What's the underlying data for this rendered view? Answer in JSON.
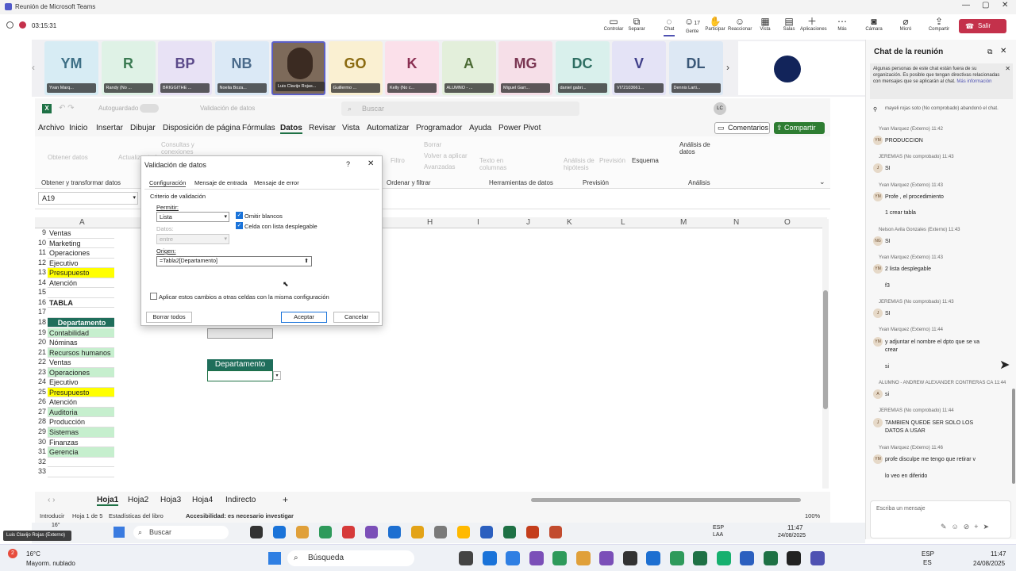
{
  "teams": {
    "window_title": "Reunión de Microsoft Teams",
    "timer": "03:15:31",
    "toolbar": [
      {
        "label": "Controlar",
        "icon": "share-screen-icon"
      },
      {
        "label": "Separar",
        "icon": "popout-icon"
      },
      {
        "label": "Chat",
        "icon": "chat-icon"
      },
      {
        "label": "Gente",
        "icon": "people-icon",
        "count": "17"
      },
      {
        "label": "Participar",
        "icon": "hand-icon"
      },
      {
        "label": "Reaccionar",
        "icon": "smile-icon"
      },
      {
        "label": "Vista",
        "icon": "grid-icon"
      },
      {
        "label": "Salas",
        "icon": "rooms-icon"
      },
      {
        "label": "Aplicaciones",
        "icon": "plus-icon"
      },
      {
        "label": "Más",
        "icon": "more-icon"
      },
      {
        "label": "Cámara",
        "icon": "camera-icon"
      },
      {
        "label": "Micró",
        "icon": "mic-off-icon"
      },
      {
        "label": "Compartir",
        "icon": "share-icon"
      }
    ],
    "leave_label": "Salir",
    "participants": [
      {
        "initials": "YM",
        "name": "Yvan Marq...",
        "bg": "#d7ecf4",
        "fg": "#3d6f85"
      },
      {
        "initials": "R",
        "name": "Randy (No ...",
        "bg": "#dff2e6",
        "fg": "#3a7a52"
      },
      {
        "initials": "BP",
        "name": "BRIGGITHE ...",
        "bg": "#e8e2f5",
        "fg": "#5b4a8a"
      },
      {
        "initials": "NB",
        "name": "Noelia Boza...",
        "bg": "#dbe9f6",
        "fg": "#4a6a8a"
      },
      {
        "initials": "",
        "name": "Luis Clavijo Rojas...",
        "bg": "#7d6a5a",
        "fg": "#fff"
      },
      {
        "initials": "GO",
        "name": "Guillermo ...",
        "bg": "#faf0d2",
        "fg": "#8a6a10"
      },
      {
        "initials": "K",
        "name": "Kelly (No c...",
        "bg": "#fbe0ea",
        "fg": "#8a2f52"
      },
      {
        "initials": "A",
        "name": "ALUMNO - ...",
        "bg": "#e3efdb",
        "fg": "#4c6b35"
      },
      {
        "initials": "MG",
        "name": "Miguel Garr...",
        "bg": "#f6dfe8",
        "fg": "#7a3652"
      },
      {
        "initials": "DC",
        "name": "daniel gabri...",
        "bg": "#d9f0ec",
        "fg": "#2e6e62"
      },
      {
        "initials": "V",
        "name": "VI72103661...",
        "bg": "#e4e3f6",
        "fg": "#3f3f8a"
      },
      {
        "initials": "DL",
        "name": "Dennis Larti...",
        "bg": "#dde8f4",
        "fg": "#3a5878"
      }
    ],
    "presenter_label": "Luis Clavijo Rojas (Externo)"
  },
  "excel": {
    "autosave": "Autoguardado",
    "file": "Validación de datos",
    "search": "Buscar",
    "user": "LC",
    "menu": [
      "Archivo",
      "Inicio",
      "Insertar",
      "Dibujar",
      "Disposición de página",
      "Fórmulas",
      "Datos",
      "Revisar",
      "Vista",
      "Automatizar",
      "Programador",
      "Ayuda",
      "Power Pivot"
    ],
    "comments": "Comentarios",
    "share": "Compartir",
    "ribbon_groups": [
      "Obtener y transformar datos",
      "Ordenar y filtrar",
      "Herramientas de datos",
      "Previsión",
      "Análisis"
    ],
    "ribbon_items": [
      "Obtener datos",
      "Actualizar todo",
      "Consultas y conexiones",
      "Borrar",
      "Volver a aplicar",
      "Avanzadas",
      "Filtro",
      "Texto en columnas",
      "Análisis de hipótesis",
      "Previsión",
      "Esquema",
      "Análisis de datos"
    ],
    "name_box": "A19",
    "columns": [
      "A",
      "H",
      "I",
      "J",
      "K",
      "L",
      "M",
      "N",
      "O"
    ],
    "rows": [
      {
        "n": "9",
        "v": "Ventas",
        "c": ""
      },
      {
        "n": "10",
        "v": "Marketing",
        "c": ""
      },
      {
        "n": "11",
        "v": "Operaciones",
        "c": ""
      },
      {
        "n": "12",
        "v": "Ejecutivo",
        "c": ""
      },
      {
        "n": "13",
        "v": "Presupuesto",
        "c": "#ffff00"
      },
      {
        "n": "14",
        "v": "Atención",
        "c": ""
      },
      {
        "n": "15",
        "v": "",
        "c": ""
      },
      {
        "n": "16",
        "v": "TABLA",
        "c": "",
        "b": true
      },
      {
        "n": "17",
        "v": "",
        "c": ""
      },
      {
        "n": "18",
        "v": "Departamento",
        "c": "#1f6e5b",
        "h": true
      },
      {
        "n": "19",
        "v": "Contabilidad",
        "c": "#c6efce"
      },
      {
        "n": "20",
        "v": "Nóminas",
        "c": ""
      },
      {
        "n": "21",
        "v": "Recursos humanos",
        "c": "#c6efce"
      },
      {
        "n": "22",
        "v": "Ventas",
        "c": ""
      },
      {
        "n": "23",
        "v": "Operaciones",
        "c": "#c6efce"
      },
      {
        "n": "24",
        "v": "Ejecutivo",
        "c": ""
      },
      {
        "n": "25",
        "v": "Presupuesto",
        "c": "#ffff00"
      },
      {
        "n": "26",
        "v": "Atención",
        "c": ""
      },
      {
        "n": "27",
        "v": "Auditoria",
        "c": "#c6efce"
      },
      {
        "n": "28",
        "v": "Producción",
        "c": ""
      },
      {
        "n": "29",
        "v": "Sistemas",
        "c": "#c6efce"
      },
      {
        "n": "30",
        "v": "Finanzas",
        "c": ""
      },
      {
        "n": "31",
        "v": "Gerencia",
        "c": "#c6efce"
      },
      {
        "n": "32",
        "v": "",
        "c": ""
      },
      {
        "n": "33",
        "v": "",
        "c": ""
      }
    ],
    "dept_header": "Departamento",
    "sheets": [
      "Hoja1",
      "Hoja2",
      "Hoja3",
      "Hoja4",
      "Indirecto"
    ],
    "status": [
      "Introducir",
      "Hoja 1 de 5",
      "Estadísticas del libro",
      "Accesibilidad: es necesario investigar"
    ],
    "zoom": "100%"
  },
  "dialog": {
    "title": "Validación de datos",
    "help": "?",
    "tabs": [
      "Configuración",
      "Mensaje de entrada",
      "Mensaje de error"
    ],
    "criteria": "Criterio de validación",
    "allow_label": "Permitir:",
    "allow_value": "Lista",
    "ignore_blank": "Omitir blancos",
    "in_cell_dropdown": "Celda con lista desplegable",
    "data_label": "Datos:",
    "data_value": "entre",
    "source_label": "Origen:",
    "source_value": "=Tabla2[Departamento]",
    "apply_all": "Aplicar estos cambios a otras celdas con la misma configuración",
    "clear_all": "Borrar todos",
    "ok": "Aceptar",
    "cancel": "Cancelar"
  },
  "chat": {
    "title": "Chat de la reunión",
    "notice": "Algunas personas de este chat están fuera de su organización. Es posible que tengan directivas relacionadas con mensajes que se aplicarán al chat.",
    "notice_link": "Más información",
    "left_msg": "mayeli rojas soto (No comprobado) abandonó el chat.",
    "messages": [
      {
        "who": "Yvan Marquez (Externo) 11:42",
        "av": "YM",
        "texts": [
          "PRODUCCION"
        ]
      },
      {
        "who": "JEREMIAS (No comprobado) 11:43",
        "av": "J",
        "texts": [
          "SI"
        ]
      },
      {
        "who": "Yvan Marquez (Externo) 11:43",
        "av": "YM",
        "texts": [
          "Profe , el procedimiento",
          "1 crear tabla"
        ]
      },
      {
        "who": "Nelson Avila Gonzales (Externo) 11:43",
        "av": "NG",
        "texts": [
          "SI"
        ]
      },
      {
        "who": "Yvan Marquez (Externo) 11:43",
        "av": "YM",
        "texts": [
          "2 lista desplegable",
          "f3"
        ]
      },
      {
        "who": "JEREMIAS (No comprobado) 11:43",
        "av": "J",
        "texts": [
          "SI"
        ]
      },
      {
        "who": "Yvan Marquez (Externo) 11:44",
        "av": "YM",
        "texts": [
          "y adjuntar el nombre el dpto que se va crear",
          "si"
        ]
      },
      {
        "who": "ALUMNO - ANDREW ALEXANDER CONTRERAS CA  11:44",
        "av": "A",
        "texts": [
          "si"
        ]
      },
      {
        "who": "JEREMIAS (No comprobado) 11:44",
        "av": "J",
        "texts": [
          "TAMBIEN QUEDE SER SOLO LOS DATOS A USAR"
        ]
      },
      {
        "who": "Yvan Marquez (Externo) 11:46",
        "av": "YM",
        "texts": [
          "profe disculpe me tengo que retirar v",
          "lo veo en diferido"
        ]
      }
    ],
    "input_placeholder": "Escriba un mensaje"
  },
  "remote_taskbar": {
    "search": "Buscar",
    "lang": "ESP LAA",
    "time": "11:47",
    "date": "24/08/2025",
    "temp": "16°"
  },
  "taskbar": {
    "weather_temp": "16°C",
    "weather_desc": "Mayorm. nublado",
    "search": "Búsqueda",
    "lang1": "ESP",
    "lang2": "ES",
    "time": "11:47",
    "date": "24/08/2025",
    "badge": "2"
  }
}
